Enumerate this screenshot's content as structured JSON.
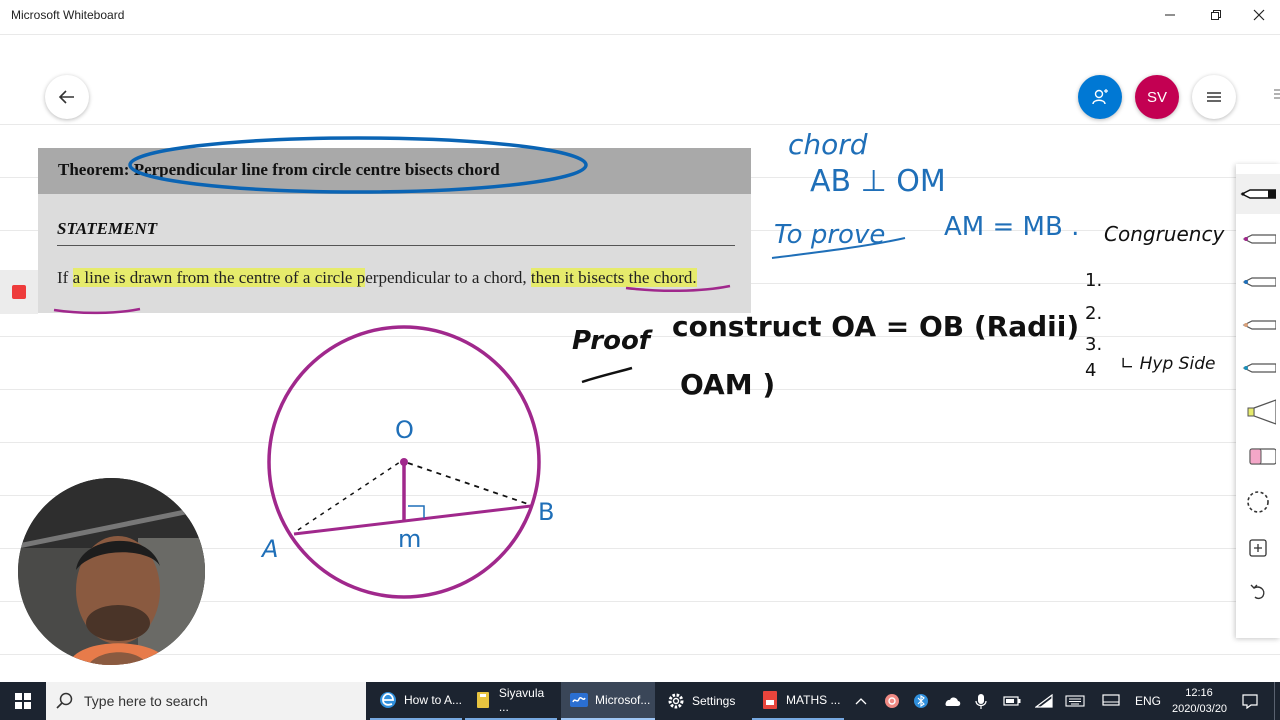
{
  "window": {
    "title": "Microsoft Whiteboard"
  },
  "theorem": {
    "title": "Theorem: Perpendicular line from circle centre bisects chord",
    "statement_label": "STATEMENT",
    "statement_parts": [
      "If ",
      "a line is drawn from the centre of a circle p",
      "erpendicular to a chord, ",
      "then it bisects the chord",
      "."
    ]
  },
  "ink": {
    "chord_label": "chord",
    "ab_perp_om": "AB ⊥ OM",
    "to_prove": "To prove",
    "am_mb": "AM = MB .",
    "congruency": "Congruency",
    "list": [
      "1.",
      "2.",
      "3.",
      "4"
    ],
    "rhs": "∟ Hyp Side",
    "proof": "Proof",
    "construct": "construct OA = OB (Radii)",
    "oam": "OAM   )",
    "point_o": "O",
    "point_a": "A",
    "point_b": "B",
    "point_m": "m"
  },
  "header_buttons": {
    "avatar_initials": "SV"
  },
  "toolbar": {
    "tools": [
      "pen-black",
      "pen-pink",
      "pen-blue",
      "pen-skin",
      "pen-teal",
      "highlighter",
      "eraser",
      "lasso",
      "add",
      "undo"
    ]
  },
  "taskbar": {
    "search_placeholder": "Type here to search",
    "apps": [
      {
        "label": "How to A...",
        "icon": "edge-icon"
      },
      {
        "label": "Siyavula ...",
        "icon": "folder-icon"
      },
      {
        "label": "Microsof...",
        "icon": "whiteboard-icon"
      },
      {
        "label": "Settings",
        "icon": "gear-icon"
      },
      {
        "label": "MATHS ...",
        "icon": "pdf-icon"
      }
    ],
    "language": "ENG",
    "time": "12:16",
    "date": "2020/03/20"
  },
  "colors": {
    "accent_blue": "#0078d4",
    "ink_blue": "#1f6fb8",
    "ink_purple": "#a0288c",
    "avatar_red": "#c30052",
    "highlight_yellow": "#e6eb6c",
    "taskbar_bg": "#1c2430"
  }
}
